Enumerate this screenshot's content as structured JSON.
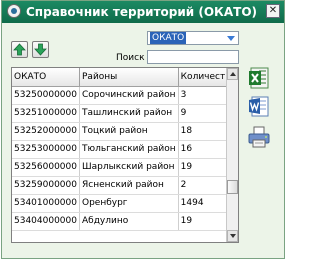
{
  "window": {
    "title": "Справочник территорий (ОКАТО)",
    "close_glyph": "✕"
  },
  "toolbar": {
    "move_up_icon": "green-up-arrow-icon",
    "move_down_icon": "green-down-arrow-icon"
  },
  "filter": {
    "field_value": "ОКАТО",
    "search_label": "Поиск",
    "search_value": ""
  },
  "table": {
    "columns": [
      "ОКАТО",
      "Районы",
      "Количество"
    ],
    "rows": [
      [
        "53250000000",
        "Сорочинский район",
        "3"
      ],
      [
        "53251000000",
        "Ташлинский район",
        "9"
      ],
      [
        "53252000000",
        "Тоцкий район",
        "18"
      ],
      [
        "53253000000",
        "Тюльганский район",
        "16"
      ],
      [
        "53256000000",
        "Шарлыкский район",
        "19"
      ],
      [
        "53259000000",
        "Ясненский район",
        "2"
      ],
      [
        "53401000000",
        "Оренбург",
        "1494"
      ],
      [
        "53404000000",
        "Абдулино",
        "19"
      ]
    ]
  },
  "side_tools": {
    "excel_icon": "excel-export-icon",
    "word_icon": "word-export-icon",
    "print_icon": "printer-icon"
  },
  "colors": {
    "titlebar": "#138060",
    "window_bg": "#ecf4e8",
    "selection": "#2a63b8"
  }
}
